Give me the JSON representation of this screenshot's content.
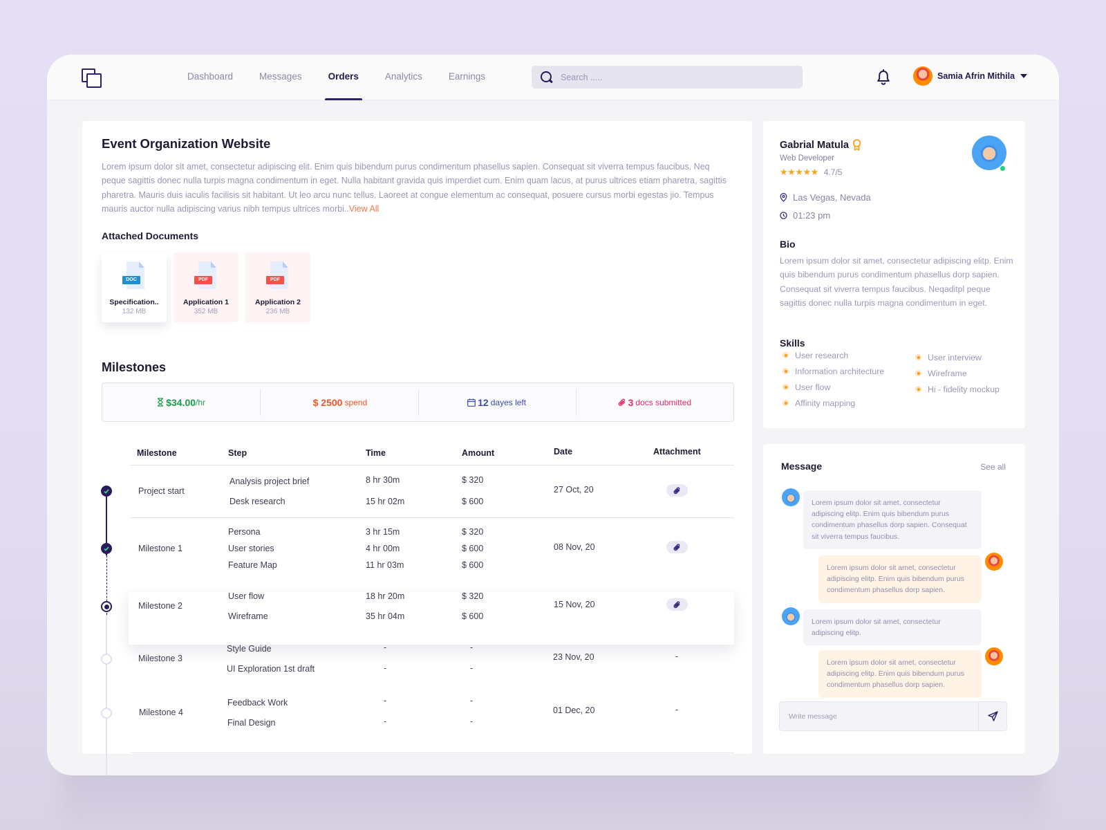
{
  "nav": {
    "items": [
      {
        "label": "Dashboard",
        "active": false
      },
      {
        "label": "Messages",
        "active": false
      },
      {
        "label": "Orders",
        "active": true
      },
      {
        "label": "Analytics",
        "active": false
      },
      {
        "label": "Earnings",
        "active": false
      }
    ],
    "search_placeholder": "Search .....",
    "user_name": "Samia Afrin Mithila"
  },
  "project": {
    "title": "Event Organization Website",
    "description": "Lorem ipsum dolor sit amet, consectetur adipiscing elit. Enim quis bibendum purus condimentum phasellus sapien. Consequat sit viverra tempus faucibus. Neq peque sagittis donec nulla turpis magna condimentum in eget. Nulla habitant gravida quis imperdiet cum. Enim quam lacus, at purus ultrices etiam pharetra, sagittis pharetra. Mauris duis iaculis facilisis sit habitant. Ut leo arcu nunc tellus. Laoreet at congue elementum ac consequat, posuere cursus morbi egestas jio. Tempus mauris auctor nulla adipiscing varius nibh tempus ultrices morbi..",
    "view_all": "View All",
    "attached_title": "Attached Documents",
    "documents": [
      {
        "type": "DOC",
        "name": "Specification..",
        "size": "132 MB",
        "tag_color": "#1d8fcf"
      },
      {
        "type": "PDF",
        "name": "Application 1",
        "size": "352 MB",
        "tag_color": "#f2524a"
      },
      {
        "type": "PDF",
        "name": "Application 2",
        "size": "236 MB",
        "tag_color": "#f2524a"
      }
    ]
  },
  "milestones": {
    "title": "Milestones",
    "stats": {
      "rate_value": "$34.00",
      "rate_unit": "/hr",
      "spend_value": "$ 2500",
      "spend_label": "spend",
      "days_value": "12",
      "days_label": "dayes left",
      "docs_value": "3",
      "docs_label": "docs submitted"
    },
    "columns": [
      "Milestone",
      "Step",
      "Time",
      "Amount",
      "Date",
      "Attachment"
    ],
    "rows": [
      {
        "name": "Project start",
        "status": "done",
        "date": "27 Oct, 20",
        "attachment": true,
        "steps": [
          {
            "step": "Analysis project brief",
            "time": "8 hr 30m",
            "amount": "$ 320"
          },
          {
            "step": "Desk research",
            "time": "15 hr 02m",
            "amount": "$ 600"
          }
        ]
      },
      {
        "name": "Milestone 1",
        "status": "done",
        "date": "08 Nov, 20",
        "attachment": true,
        "steps": [
          {
            "step": "Persona",
            "time": "3 hr 15m",
            "amount": "$ 320"
          },
          {
            "step": "User stories",
            "time": "4 hr 00m",
            "amount": "$ 600"
          },
          {
            "step": "Feature Map",
            "time": "11 hr 03m",
            "amount": "$ 600"
          }
        ]
      },
      {
        "name": "Milestone 2",
        "status": "current",
        "date": "15 Nov, 20",
        "attachment": true,
        "steps": [
          {
            "step": "User flow",
            "time": "18 hr 20m",
            "amount": "$ 320"
          },
          {
            "step": "Wireframe",
            "time": "35 hr 04m",
            "amount": "$ 600"
          }
        ]
      },
      {
        "name": "Milestone 3",
        "status": "todo",
        "date": "23 Nov, 20",
        "attachment": false,
        "attachment_text": "-",
        "steps": [
          {
            "step": "Style Guide",
            "time": "-",
            "amount": "-"
          },
          {
            "step": "UI Exploration 1st draft",
            "time": "-",
            "amount": "-"
          }
        ]
      },
      {
        "name": "Milestone 4",
        "status": "todo",
        "date": "01 Dec, 20",
        "attachment": false,
        "attachment_text": "-",
        "steps": [
          {
            "step": "Feedback Work",
            "time": "-",
            "amount": "-"
          },
          {
            "step": "Final Design",
            "time": "-",
            "amount": "-"
          }
        ]
      }
    ]
  },
  "profile": {
    "name": "Gabrial Matula",
    "role": "Web Developer",
    "rating": "4.7/5",
    "rating_value": 4.7,
    "location": "Las Vegas, Nevada",
    "time": "01:23 pm",
    "bio_title": "Bio",
    "bio": "Lorem ipsum dolor sit amet, consectetur adipiscing elitp. Enim quis bibendum purus condimentum phasellus dorp sapien. Consequat sit viverra tempus faucibus. Neqaditpl peque sagittis donec nulla turpis magna condimentum in eget.",
    "skills_title": "Skills",
    "skills_left": [
      "User research",
      "Information architecture",
      "User flow",
      "Affinity mapping"
    ],
    "skills_right": [
      "User interview",
      "Wireframe",
      "Hi - fidelity mockup"
    ]
  },
  "messages": {
    "title": "Message",
    "see_all": "See all",
    "items": [
      {
        "from": "other",
        "text": "Lorem ipsum dolor sit amet, consectetur adipiscing elitp. Enim quis bibendum purus condimentum phasellus dorp sapien. Consequat sit viverra tempus faucibus."
      },
      {
        "from": "me",
        "text": "Lorem ipsum dolor sit amet, consectetur adipiscing elitp. Enim quis bibendum purus condimentum phasellus dorp sapien."
      },
      {
        "from": "other",
        "text": "Lorem ipsum dolor sit amet, consectetur adipiscing elitp."
      },
      {
        "from": "me",
        "text": "Lorem ipsum dolor sit amet, consectetur adipiscing elitp. Enim quis bibendum  purus condimentum phasellus dorp sapien."
      }
    ],
    "input_placeholder": "Write message"
  }
}
